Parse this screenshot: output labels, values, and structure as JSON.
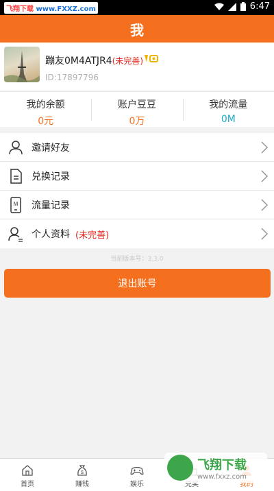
{
  "status_bar": {
    "watermark_part1": "飞翔下载",
    "watermark_part2": "www.FXXZ.com",
    "time": "6:47"
  },
  "header": {
    "title": "我"
  },
  "profile": {
    "username": "蹦友0M4ATJR4",
    "incomplete_tag": "(未完善)",
    "user_id": "ID:17897796"
  },
  "stats": [
    {
      "label": "我的余额",
      "value": "0元",
      "color": "#f5701e"
    },
    {
      "label": "账户豆豆",
      "value": "0万",
      "color": "#f5701e"
    },
    {
      "label": "我的流量",
      "value": "0M",
      "color": "#1ab0c8"
    }
  ],
  "menu": [
    {
      "label": "邀请好友",
      "icon": "person-icon"
    },
    {
      "label": "兑换记录",
      "icon": "document-icon"
    },
    {
      "label": "流量记录",
      "icon": "phone-m-icon"
    },
    {
      "label": "个人资料",
      "extra": "(未完善)",
      "icon": "profile-icon"
    }
  ],
  "version": "当前版本号：3.3.0",
  "logout_label": "退出账号",
  "tabs": [
    {
      "label": "首页",
      "icon": "home-icon"
    },
    {
      "label": "赚钱",
      "icon": "money-bag-icon"
    },
    {
      "label": "娱乐",
      "icon": "gamepad-icon"
    },
    {
      "label": "兑奖",
      "icon": "gift-icon"
    },
    {
      "label": "我的",
      "icon": "me-icon"
    }
  ],
  "corner_watermark": {
    "title": "飞翔下载",
    "url": "www.fxxz.com"
  },
  "colors": {
    "accent": "#f5701e",
    "alert": "#e0251c",
    "cyan": "#1ab0c8"
  }
}
